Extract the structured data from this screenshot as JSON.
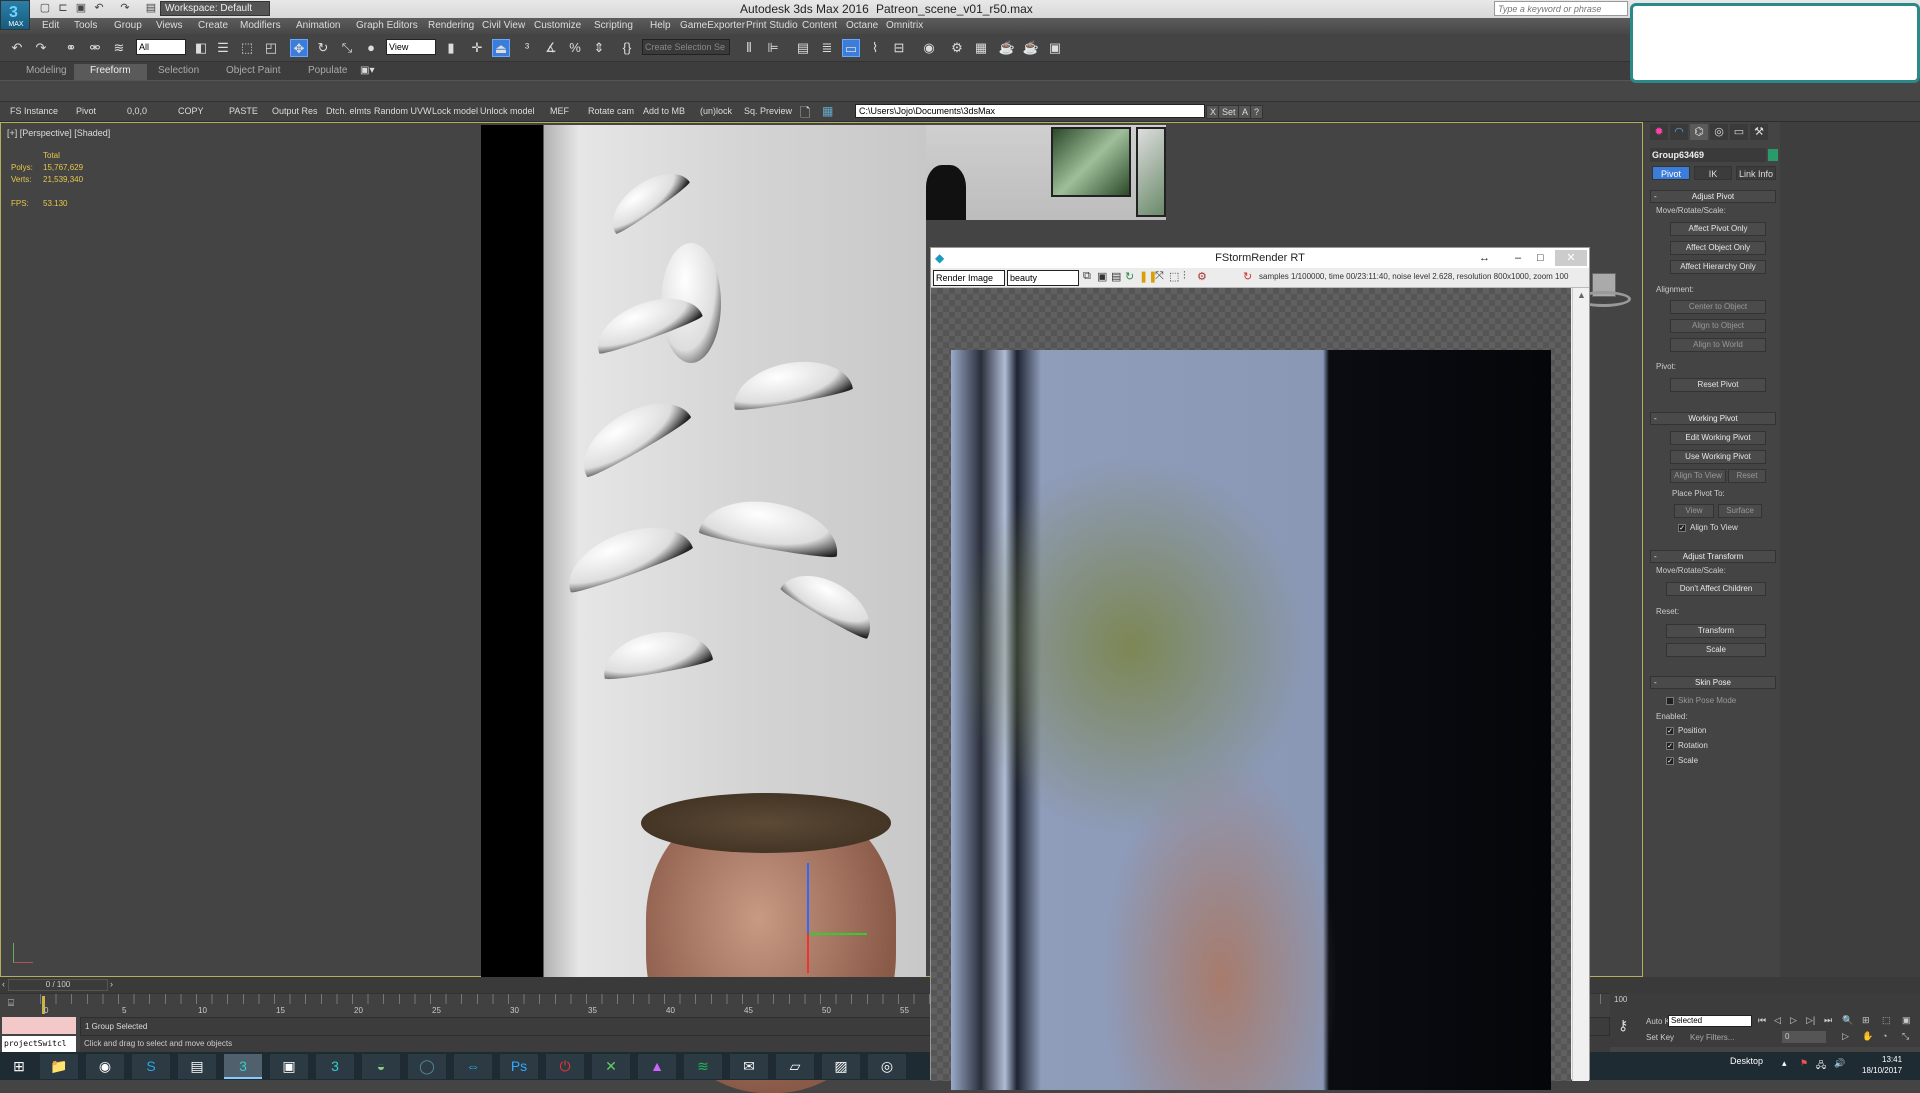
{
  "titlebar": {
    "app_title": "Autodesk 3ds Max 2016",
    "scene_title": "Patreon_scene_v01_r50.max",
    "workspace": "Workspace: Default",
    "search_placeholder": "Type a keyword or phrase",
    "logo_label": "MAX"
  },
  "menubar": {
    "items": [
      "Edit",
      "Tools",
      "Group",
      "Views",
      "Create",
      "Modifiers",
      "Animation",
      "Graph Editors",
      "Rendering",
      "Civil View",
      "Customize",
      "Scripting",
      "Help",
      "GameExporter",
      "Print Studio",
      "Content",
      "Octane",
      "Omnitrix"
    ]
  },
  "toolbar": {
    "selection_filter": "All",
    "ref_coord": "View",
    "named_selection": "Create Selection Se"
  },
  "ribbon": {
    "tabs": [
      "Modeling",
      "Freeform",
      "Selection",
      "Object Paint",
      "Populate"
    ],
    "active_tab": "Freeform"
  },
  "scriptbar": {
    "buttons": [
      "FS Instance",
      "Pivot",
      "0,0,0",
      "COPY",
      "PASTE",
      "Output Res",
      "Dtch. elmts",
      "Random UVW",
      "Lock model",
      "Unlock model",
      "MEF",
      "Rotate cam",
      "Add to MB",
      "(un)lock",
      "Sq. Preview"
    ],
    "path_value": "C:\\Users\\Jojo\\Documents\\3dsMax",
    "path_buttons": [
      "X",
      "Set",
      "A",
      "?"
    ]
  },
  "viewport": {
    "label": "[+] [Perspective] [Shaded]",
    "stats": {
      "total_label": "Total",
      "polys_label": "Polys:",
      "polys": "15,767,629",
      "verts_label": "Verts:",
      "verts": "21,539,340",
      "fps_label": "FPS:",
      "fps": "53.130"
    }
  },
  "render_window": {
    "title": "FStormRender RT",
    "channel_select": "Render Image",
    "pass_select": "beauty",
    "status": "samples 1/100000,  time 00/23:11:40,  noise level 2.628,  resolution 800x1000,  zoom 100"
  },
  "command_panel": {
    "object_name": "Group63469",
    "object_color": "#2a9a6a",
    "tabs": [
      "Pivot",
      "IK",
      "Link Info"
    ],
    "active_tab": "Pivot",
    "adjust_pivot": {
      "title": "Adjust Pivot",
      "move_label": "Move/Rotate/Scale:",
      "buttons": [
        "Affect Pivot Only",
        "Affect Object Only",
        "Affect Hierarchy Only"
      ],
      "alignment_label": "Alignment:",
      "align_buttons": [
        "Center to Object",
        "Align to Object",
        "Align to World"
      ],
      "pivot_label": "Pivot:",
      "reset_button": "Reset Pivot"
    },
    "working_pivot": {
      "title": "Working Pivot",
      "edit": "Edit Working Pivot",
      "use": "Use Working Pivot",
      "align_to_view": "Align To View",
      "reset": "Reset",
      "place_label": "Place Pivot To:",
      "view": "View",
      "surface": "Surface",
      "align_check": "Align To View",
      "align_checked": true
    },
    "adjust_transform": {
      "title": "Adjust Transform",
      "move_label": "Move/Rotate/Scale:",
      "dont_affect": "Don't Affect Children",
      "reset_label": "Reset:",
      "transform": "Transform",
      "scale": "Scale"
    },
    "skin_pose": {
      "title": "Skin Pose",
      "mode": "Skin Pose Mode",
      "mode_checked": false,
      "enabled_label": "Enabled:",
      "checks": [
        {
          "label": "Position",
          "checked": true
        },
        {
          "label": "Rotation",
          "checked": true
        },
        {
          "label": "Scale",
          "checked": true
        }
      ]
    }
  },
  "timeline": {
    "slider": "0 / 100",
    "ticks": [
      "0",
      "5",
      "10",
      "15",
      "20",
      "25",
      "30",
      "35",
      "40",
      "45",
      "50",
      "55"
    ],
    "end_tick": "100"
  },
  "status": {
    "selection": "1 Group Selected",
    "prompt": "Click and drag to select and move objects",
    "listener": "projectSwitcl"
  },
  "anim_controls": {
    "auto_key": "Auto Key",
    "set_key": "Set Key",
    "key_mode": "Selected",
    "key_filters": "Key Filters...",
    "frame": "0"
  },
  "taskbar": {
    "apps": [
      "File Explorer",
      "Chrome",
      "Skype",
      "Notepad++",
      "3ds Max",
      "Remote Desktop",
      "3ds Max alt",
      "Plex",
      "Cloud",
      "TeamViewer",
      "Photoshop",
      "Power",
      "Xbox",
      "Affinity",
      "Spotify",
      "Mail",
      "Notes",
      "Photos",
      "OBS"
    ],
    "active_app": "3ds Max",
    "desktop_label": "Desktop",
    "time": "13:41",
    "date": "18/10/2017"
  }
}
